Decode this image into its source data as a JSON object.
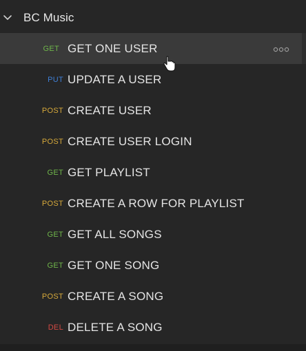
{
  "sidebar": {
    "collection": {
      "name": "BC Music",
      "icon": "chevron-down-icon"
    },
    "requests": [
      {
        "method": "GET",
        "name": "GET ONE USER",
        "color": "#6fb54a"
      },
      {
        "method": "PUT",
        "name": "UPDATE A USER",
        "color": "#3f7fd6"
      },
      {
        "method": "POST",
        "name": "CREATE USER",
        "color": "#d6a93b"
      },
      {
        "method": "POST",
        "name": "CREATE USER LOGIN",
        "color": "#d6a93b"
      },
      {
        "method": "GET",
        "name": "GET PLAYLIST",
        "color": "#6fb54a"
      },
      {
        "method": "POST",
        "name": "CREATE A ROW FOR PLAYLIST",
        "color": "#d6a93b"
      },
      {
        "method": "GET",
        "name": "GET ALL SONGS",
        "color": "#6fb54a"
      },
      {
        "method": "GET",
        "name": "GET ONE SONG",
        "color": "#6fb54a"
      },
      {
        "method": "POST",
        "name": "CREATE A SONG",
        "color": "#d6a93b"
      },
      {
        "method": "DEL",
        "name": "DELETE A SONG",
        "color": "#d44a44"
      }
    ],
    "active_request_icon": "more-options-icon"
  }
}
